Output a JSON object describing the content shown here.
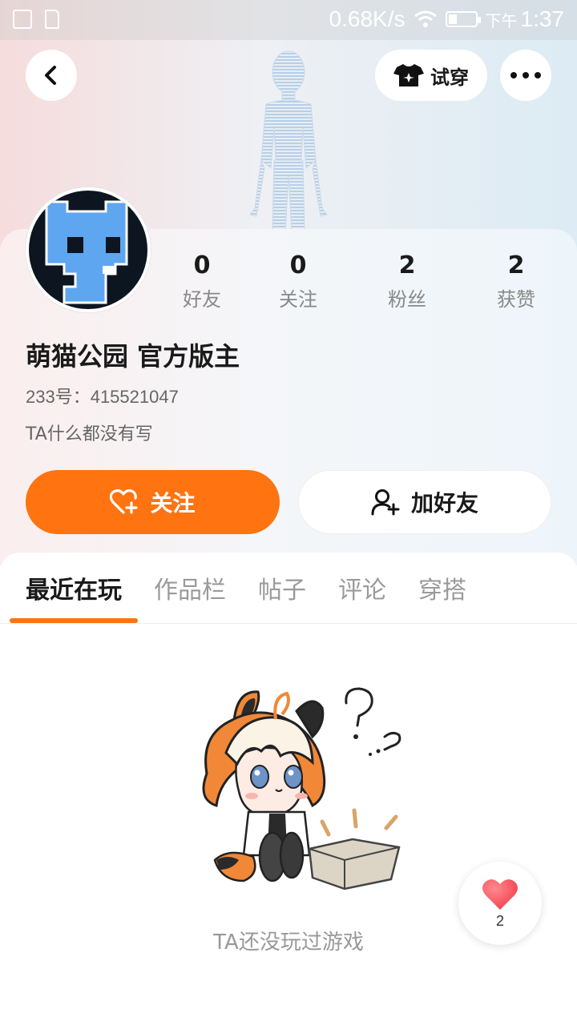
{
  "status_bar": {
    "speed": "0.68K/s",
    "ampm": "下午",
    "time": "1:37"
  },
  "header": {
    "try_on_label": "试穿"
  },
  "profile": {
    "name": "萌猫公园 官方版主",
    "id_text": "233号：415521047",
    "bio": "TA什么都没有写",
    "avatar_icon": "blue-pixel-creature-icon"
  },
  "stats": [
    {
      "value": "0",
      "label": "好友"
    },
    {
      "value": "0",
      "label": "关注"
    },
    {
      "value": "2",
      "label": "粉丝"
    },
    {
      "value": "2",
      "label": "获赞"
    }
  ],
  "actions": {
    "follow_label": "关注",
    "add_friend_label": "加好友"
  },
  "tabs": [
    {
      "label": "最近在玩",
      "active": true
    },
    {
      "label": "作品栏",
      "active": false
    },
    {
      "label": "帖子",
      "active": false
    },
    {
      "label": "评论",
      "active": false
    },
    {
      "label": "穿搭",
      "active": false
    }
  ],
  "empty_state": {
    "text": "TA还没玩过游戏"
  },
  "like_fab": {
    "count": "2"
  },
  "colors": {
    "accent": "#ff7310",
    "avatar_blue": "#5ea6f0",
    "heart": "#ff4d5a"
  }
}
